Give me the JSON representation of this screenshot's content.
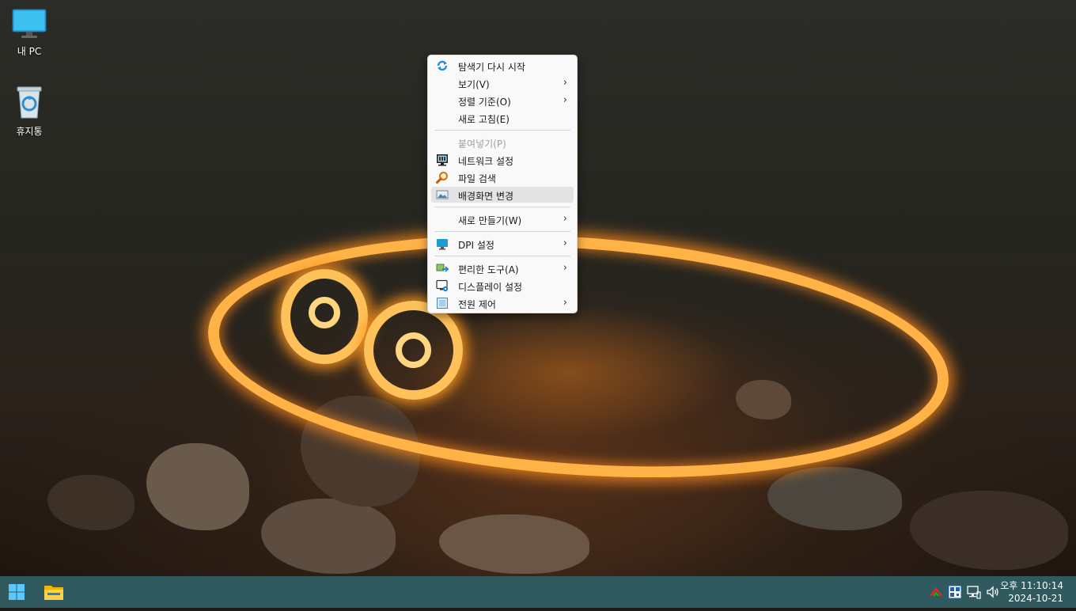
{
  "desktop": {
    "icons": [
      {
        "label": "내 PC",
        "icon": "monitor-icon"
      },
      {
        "label": "휴지통",
        "icon": "recycle-bin-icon"
      }
    ]
  },
  "context_menu": {
    "items": [
      {
        "label": "탐색기 다시 시작",
        "icon": "refresh-icon",
        "submenu": false,
        "enabled": true
      },
      {
        "label": "보기(V)",
        "submenu": true,
        "enabled": true
      },
      {
        "label": "정렬 기준(O)",
        "submenu": true,
        "enabled": true
      },
      {
        "label": "새로 고침(E)",
        "submenu": false,
        "enabled": true
      },
      {
        "label": "붙여넣기(P)",
        "submenu": false,
        "enabled": false
      },
      {
        "label": "네트워크 설정",
        "icon": "network-icon",
        "submenu": false,
        "enabled": true
      },
      {
        "label": "파일 검색",
        "icon": "magnifier-icon",
        "submenu": false,
        "enabled": true
      },
      {
        "label": "배경화면 변경",
        "icon": "wallpaper-icon",
        "submenu": false,
        "enabled": true,
        "highlighted": true
      },
      {
        "label": "새로 만들기(W)",
        "submenu": true,
        "enabled": true
      },
      {
        "label": "DPI 설정",
        "icon": "display-icon",
        "submenu": true,
        "enabled": true
      },
      {
        "label": "편리한 도구(A)",
        "icon": "tools-icon",
        "submenu": true,
        "enabled": true
      },
      {
        "label": "디스플레이 설정",
        "icon": "display-settings-icon",
        "submenu": false,
        "enabled": true
      },
      {
        "label": "전원 제어",
        "icon": "power-icon",
        "submenu": true,
        "enabled": true
      }
    ],
    "submenu_glyph": "›"
  },
  "taskbar": {
    "start_icon": "windows-start-icon",
    "pinned": [
      {
        "icon": "file-explorer-icon"
      }
    ],
    "tray_icons": [
      "upload-arrow-icon",
      "qr-app-icon",
      "network-status-icon",
      "volume-icon"
    ],
    "clock": {
      "time": "오후 11:10:14",
      "date": "2024-10-21"
    }
  },
  "colors": {
    "taskbar": "#325f64",
    "menu_bg": "#f9f9f9",
    "menu_highlight": "#e3e3e3",
    "fire": "#ffb030"
  }
}
